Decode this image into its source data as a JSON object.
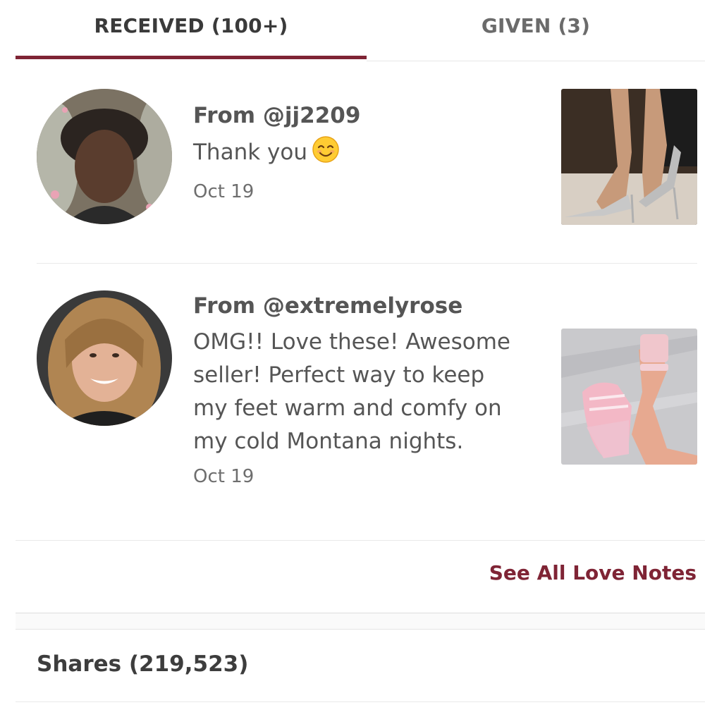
{
  "tabs": {
    "received_label": "RECEIVED (100+)",
    "given_label": "GIVEN (3)"
  },
  "notes": [
    {
      "from": "From @jj2209",
      "message": "Thank you",
      "emoji_icon": "smiling-face-icon",
      "date": "Oct 19"
    },
    {
      "from": "From @extremelyrose",
      "message_lines": [
        "OMG!! Love these! Awesome",
        "seller! Perfect way to keep",
        "my feet warm and comfy on",
        "my cold Montana nights."
      ],
      "date": "Oct 19"
    }
  ],
  "see_all_label": "See All Love Notes",
  "shares_label": "Shares (219,523)",
  "colors": {
    "accent": "#7f2435",
    "text": "#555555",
    "divider": "#e9e9e9"
  }
}
